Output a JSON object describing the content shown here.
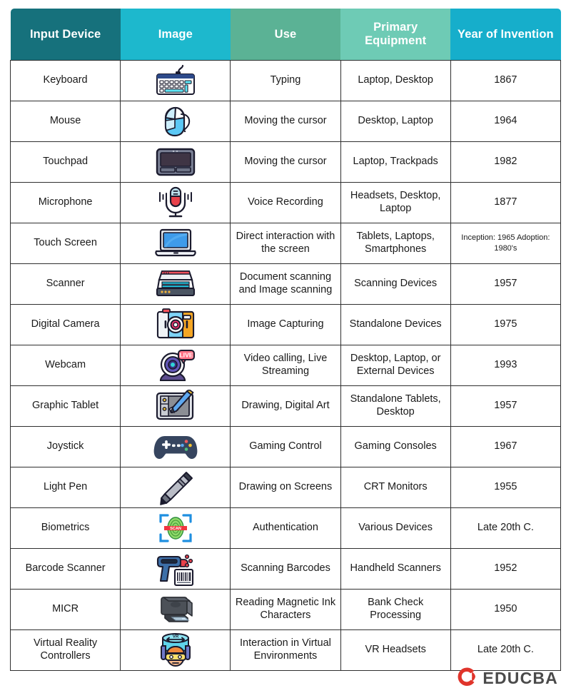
{
  "table": {
    "headers": [
      {
        "label": "Input Device",
        "color": "#16717c",
        "key": "device"
      },
      {
        "label": "Image",
        "color": "#1db8cd",
        "key": "image"
      },
      {
        "label": "Use",
        "color": "#5bb295",
        "key": "use"
      },
      {
        "label": "Primary Equipment",
        "color": "#6ecbb5",
        "key": "equipment"
      },
      {
        "label": "Year of Invention",
        "color": "#16aecb",
        "key": "year"
      }
    ],
    "rows": [
      {
        "device": "Keyboard",
        "icon": "keyboard-icon",
        "use": "Typing",
        "equipment": "Laptop, Desktop",
        "year": "1867"
      },
      {
        "device": "Mouse",
        "icon": "mouse-icon",
        "use": "Moving the cursor",
        "equipment": "Desktop, Laptop",
        "year": "1964"
      },
      {
        "device": "Touchpad",
        "icon": "touchpad-icon",
        "use": "Moving the cursor",
        "equipment": "Laptop, Trackpads",
        "year": "1982"
      },
      {
        "device": "Microphone",
        "icon": "microphone-icon",
        "use": "Voice Recording",
        "equipment": "Headsets, Desktop, Laptop",
        "year": "1877"
      },
      {
        "device": "Touch Screen",
        "icon": "laptop-touchscreen-icon",
        "use": "Direct interaction with the screen",
        "equipment": "Tablets, Laptops, Smartphones",
        "year": "Inception: 1965 Adoption: 1980's",
        "year_small": true
      },
      {
        "device": "Scanner",
        "icon": "scanner-icon",
        "use": "Document scanning and Image scanning",
        "equipment": "Scanning Devices",
        "year": "1957"
      },
      {
        "device": "Digital Camera",
        "icon": "camera-icon",
        "use": "Image Capturing",
        "equipment": "Standalone Devices",
        "year": "1975"
      },
      {
        "device": "Webcam",
        "icon": "webcam-icon",
        "use": "Video calling, Live Streaming",
        "equipment": "Desktop, Laptop, or External Devices",
        "year": "1993"
      },
      {
        "device": "Graphic Tablet",
        "icon": "graphic-tablet-icon",
        "use": "Drawing, Digital Art",
        "equipment": "Standalone Tablets, Desktop",
        "year": "1957"
      },
      {
        "device": "Joystick",
        "icon": "gamepad-icon",
        "use": "Gaming Control",
        "equipment": "Gaming Consoles",
        "year": "1967"
      },
      {
        "device": "Light Pen",
        "icon": "light-pen-icon",
        "use": "Drawing on Screens",
        "equipment": "CRT Monitors",
        "year": "1955"
      },
      {
        "device": "Biometrics",
        "icon": "fingerprint-scan-icon",
        "use": "Authentication",
        "equipment": "Various Devices",
        "year": "Late 20th C."
      },
      {
        "device": "Barcode Scanner",
        "icon": "barcode-scanner-icon",
        "use": "Scanning Barcodes",
        "equipment": "Handheld Scanners",
        "year": "1952"
      },
      {
        "device": "MICR",
        "icon": "micr-reader-icon",
        "use": "Reading Magnetic Ink Characters",
        "equipment": "Bank Check Processing",
        "year": "1950"
      },
      {
        "device": "Virtual Reality Controllers",
        "icon": "vr-headset-icon",
        "use": "Interaction in Virtual Environments",
        "equipment": "VR Headsets",
        "year": "Late 20th C."
      }
    ]
  },
  "footer": {
    "brand": "EDUCBA",
    "logo_color": "#e0342b",
    "word_color": "#4a4a4a"
  }
}
